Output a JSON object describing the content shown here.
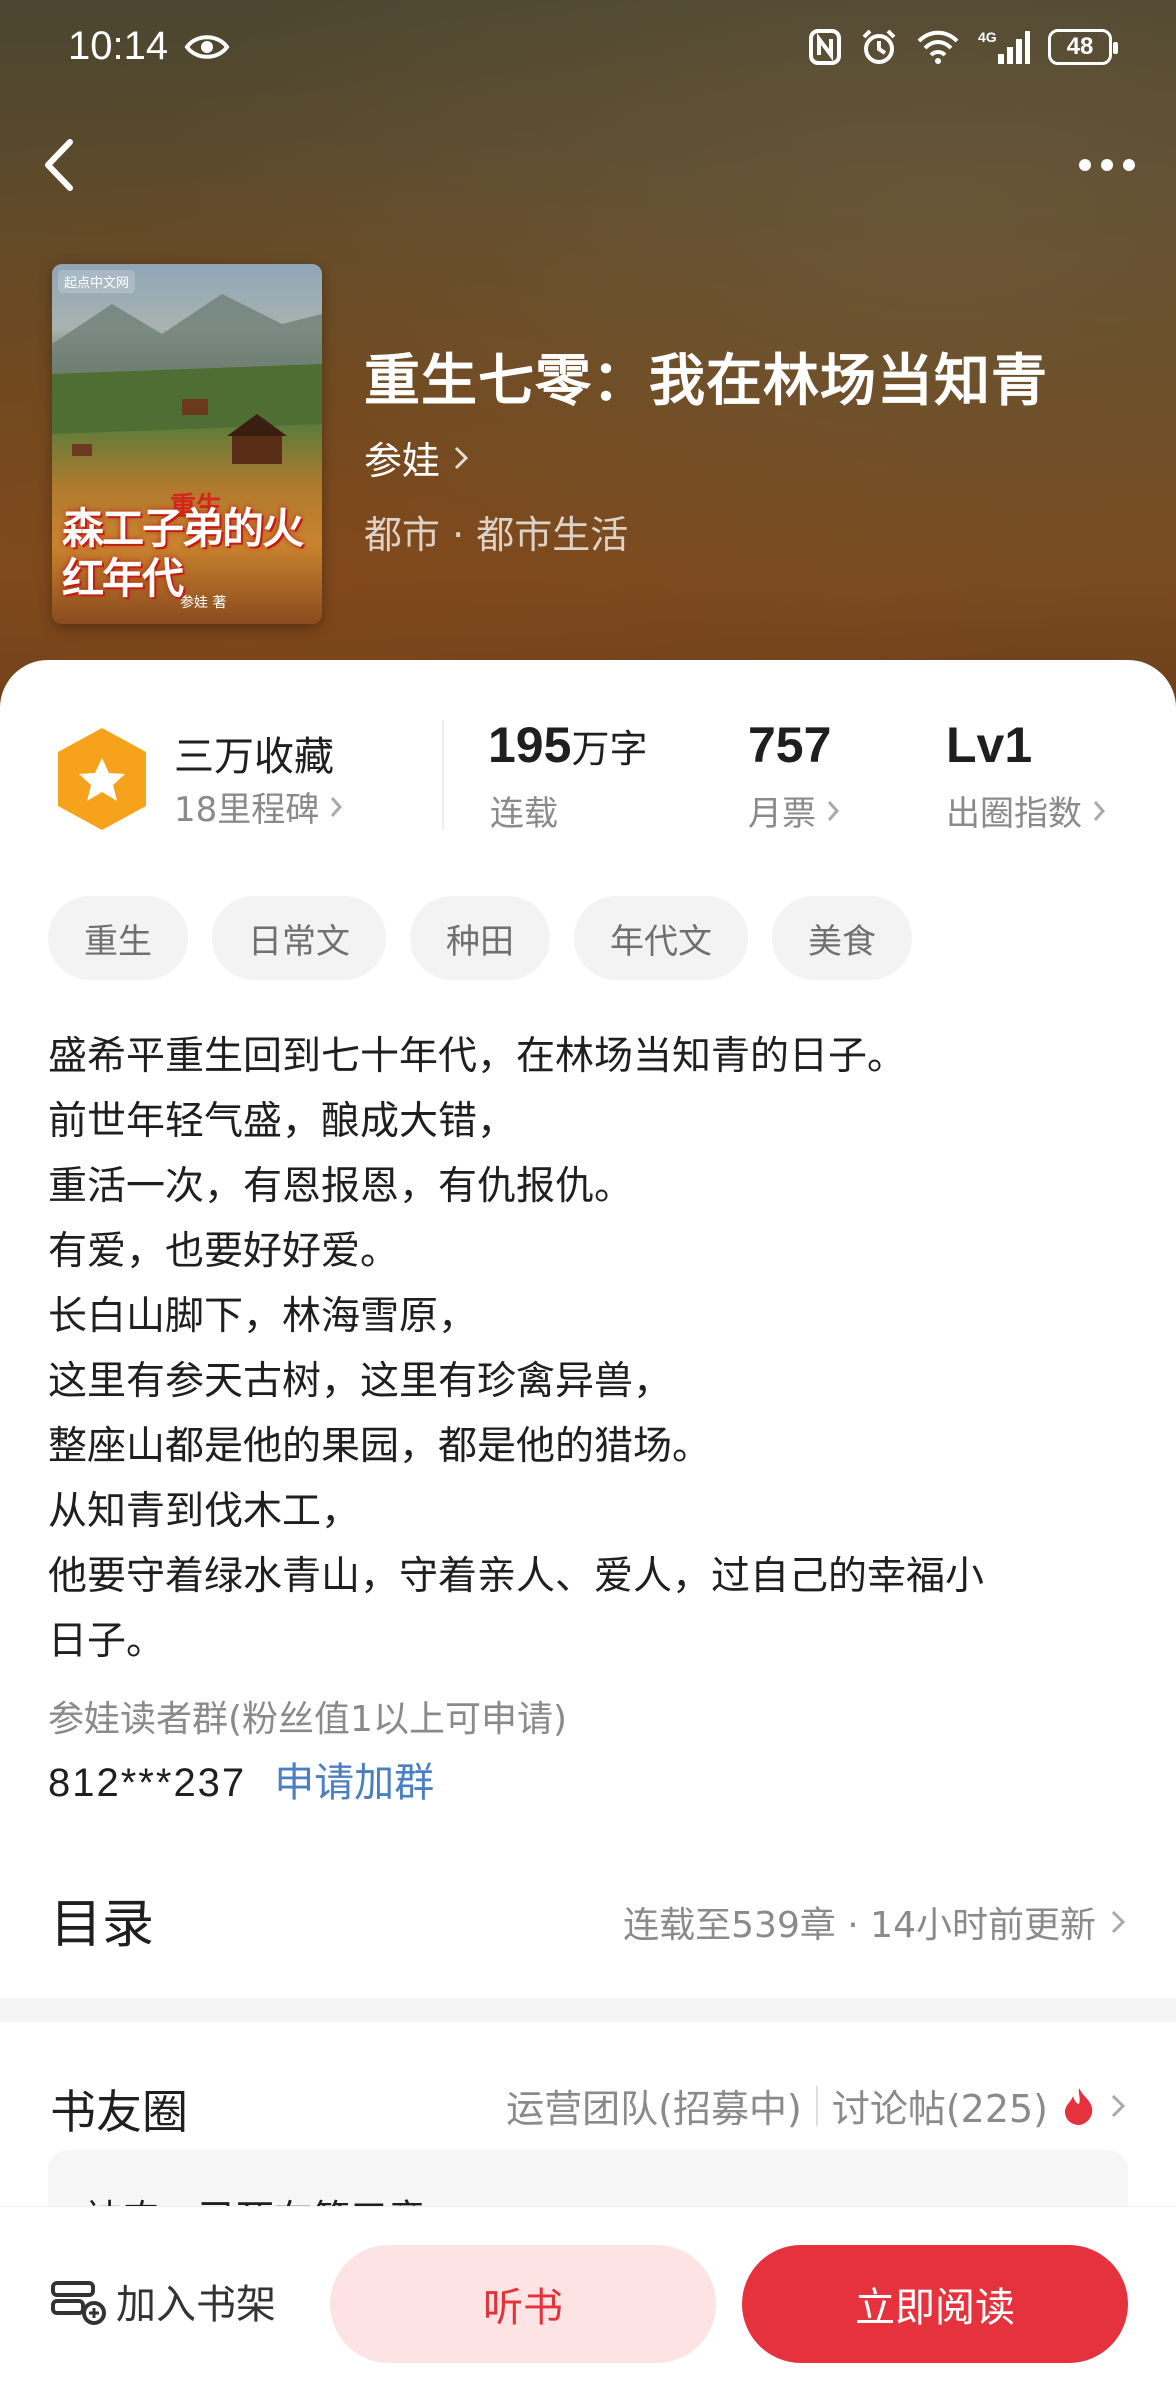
{
  "status_bar": {
    "time": "10:14",
    "battery": "48",
    "network": "4G"
  },
  "header": {
    "cover": {
      "publisher_logo": "起点中文网",
      "title_small": "重生",
      "title_art": "森工子弟的火红年代",
      "author": "参娃 著"
    },
    "title": "重生七零：我在林场当知青",
    "author": "参娃",
    "genre": "都市 · 都市生活"
  },
  "stats": {
    "favorites_label": "三万收藏",
    "milestones_label": "18里程碑",
    "word_count": "195",
    "word_unit": "万字",
    "status": "连载",
    "monthly_votes": "757",
    "monthly_votes_label": "月票",
    "level": "Lv1",
    "level_label": "出圈指数"
  },
  "tags": [
    "重生",
    "日常文",
    "种田",
    "年代文",
    "美食"
  ],
  "description": [
    "盛希平重生回到七十年代，在林场当知青的日子。",
    "前世年轻气盛，酿成大错，",
    "重活一次，有恩报恩，有仇报仇。",
    "有爱，也要好好爱。",
    "长白山脚下，林海雪原，",
    "这里有参天古树，这里有珍禽异兽，",
    "整座山都是他的果园，都是他的猎场。",
    "从知青到伐木工，",
    "他要守着绿水青山，守着亲人、爱人，过自己的幸福小",
    "日子。"
  ],
  "reader_group": {
    "label": "参娃读者群(粉丝值1以上可申请)",
    "number": "812***237",
    "apply_label": "申请加群"
  },
  "toc": {
    "title": "目录",
    "info": "连载至539章 · 14小时前更新"
  },
  "book_circle": {
    "title": "书友圈",
    "ops_team": "运营团队(招募中)",
    "discussions": "讨论帖(225)",
    "preview_text": "神农，已死在第五章"
  },
  "bottom_bar": {
    "add_shelf": "加入书架",
    "listen": "听书",
    "read_now": "立即阅读"
  },
  "colors": {
    "accent_red": "#e6323d",
    "listen_bg": "#fde3e3",
    "link_blue": "#4a7fc1",
    "badge_orange": "#f7a21b"
  }
}
